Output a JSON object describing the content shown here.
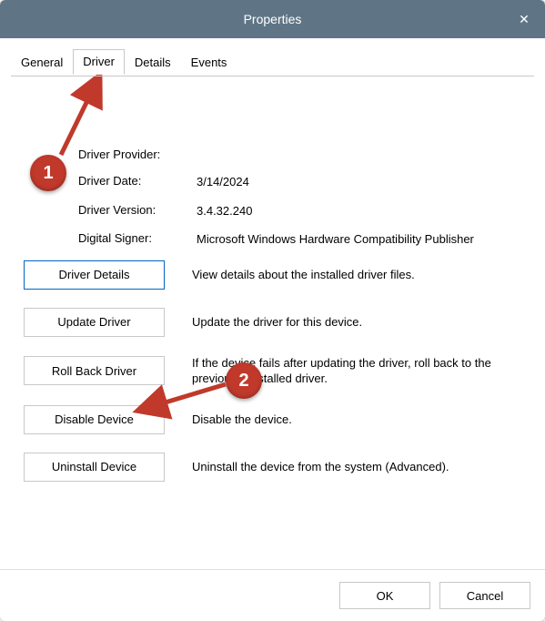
{
  "window": {
    "title": "Properties",
    "close_symbol": "✕"
  },
  "tabs": [
    {
      "label": "General",
      "active": false
    },
    {
      "label": "Driver",
      "active": true
    },
    {
      "label": "Details",
      "active": false
    },
    {
      "label": "Events",
      "active": false
    }
  ],
  "driver_info": {
    "provider_label": "Driver Provider:",
    "provider_value": "",
    "date_label": "Driver Date:",
    "date_value": "3/14/2024",
    "version_label": "Driver Version:",
    "version_value": "3.4.32.240",
    "signer_label": "Digital Signer:",
    "signer_value": "Microsoft Windows Hardware Compatibility Publisher"
  },
  "actions": {
    "details": {
      "button": "Driver Details",
      "desc": "View details about the installed driver files."
    },
    "update": {
      "button": "Update Driver",
      "desc": "Update the driver for this device."
    },
    "rollback": {
      "button": "Roll Back Driver",
      "desc": "If the device fails after updating the driver, roll back to the previously installed driver."
    },
    "disable": {
      "button": "Disable Device",
      "desc": "Disable the device."
    },
    "uninstall": {
      "button": "Uninstall Device",
      "desc": "Uninstall the device from the system (Advanced)."
    }
  },
  "footer": {
    "ok": "OK",
    "cancel": "Cancel"
  },
  "annotations": {
    "badge1": "1",
    "badge2": "2"
  }
}
